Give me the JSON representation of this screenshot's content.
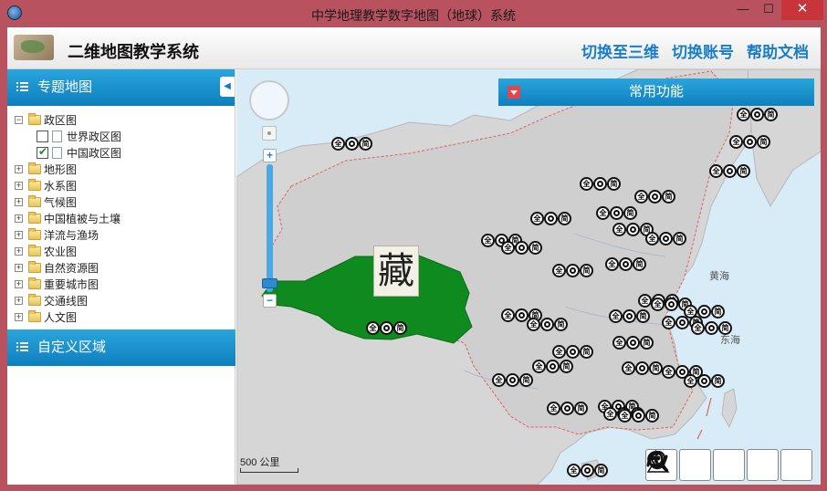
{
  "window": {
    "title": "中学地理教学数字地图（地球）系统",
    "min": "—",
    "max": "☐",
    "close": "✕"
  },
  "header": {
    "app_name": "二维地图教学系统",
    "links": [
      "切换至三维",
      "切换账号",
      "帮助文档"
    ]
  },
  "sidebar": {
    "thematic_title": "专题地图",
    "collapse_glyph": "◀",
    "tree": [
      {
        "label": "政区图",
        "expanded": true,
        "children": [
          {
            "label": "世界政区图",
            "checked": false
          },
          {
            "label": "中国政区图",
            "checked": true
          }
        ]
      },
      {
        "label": "地形图"
      },
      {
        "label": "水系图"
      },
      {
        "label": "气候图"
      },
      {
        "label": "中国植被与土壤"
      },
      {
        "label": "洋流与渔场"
      },
      {
        "label": "农业图"
      },
      {
        "label": "自然资源图"
      },
      {
        "label": "重要城市图"
      },
      {
        "label": "交通线图"
      },
      {
        "label": "人文图"
      }
    ],
    "custom_title": "自定义区域"
  },
  "map": {
    "function_bar": "常用功能",
    "zoom_in": "+",
    "zoom_out": "−",
    "region_tag": "藏",
    "scale_label": "500 公里",
    "sea_labels": [
      "黄海",
      "东海"
    ],
    "marker_glyphs": [
      "全",
      "",
      "简"
    ],
    "tools": [
      "zoom-in-icon",
      "zoom-out-icon",
      "refresh-icon",
      "locate-icon",
      "draw-icon"
    ],
    "colors": {
      "land": "#d6d6d6",
      "tibet": "#0f8a1e",
      "sea": "#d8ecf8",
      "accent": "#1a7ec4"
    }
  }
}
